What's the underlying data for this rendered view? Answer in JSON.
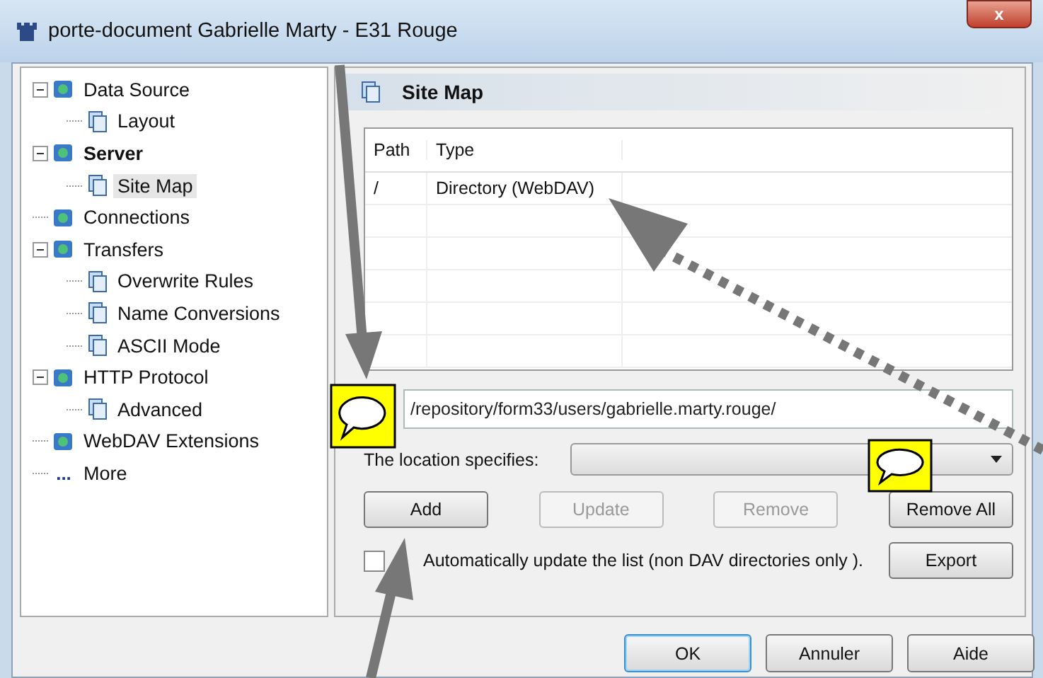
{
  "window": {
    "title": "porte-document Gabrielle Marty - E31 Rouge",
    "close": "x"
  },
  "tree": [
    {
      "label": "Data Source",
      "bold": false,
      "selected": false,
      "expanded": true,
      "children": [
        {
          "label": "Layout",
          "bold": false,
          "selected": false
        }
      ]
    },
    {
      "label": "Server",
      "bold": true,
      "selected": false,
      "expanded": true,
      "children": [
        {
          "label": "Site Map",
          "bold": false,
          "selected": true
        }
      ]
    },
    {
      "label": "Connections",
      "bold": false,
      "selected": false
    },
    {
      "label": "Transfers",
      "bold": false,
      "selected": false,
      "expanded": true,
      "children": [
        {
          "label": "Overwrite Rules",
          "bold": false,
          "selected": false
        },
        {
          "label": "Name Conversions",
          "bold": false,
          "selected": false
        },
        {
          "label": "ASCII Mode",
          "bold": false,
          "selected": false
        }
      ]
    },
    {
      "label": "HTTP Protocol",
      "bold": false,
      "selected": false,
      "expanded": true,
      "children": [
        {
          "label": "Advanced",
          "bold": false,
          "selected": false
        }
      ]
    },
    {
      "label": "WebDAV Extensions",
      "bold": false,
      "selected": false
    },
    {
      "label": "More",
      "bold": false,
      "selected": false,
      "kind": "more",
      "icon": "..."
    }
  ],
  "panel": {
    "title": "Site Map",
    "table": {
      "columns": [
        "Path",
        "Type"
      ],
      "rows": [
        [
          "/",
          "Directory (WebDAV)"
        ]
      ]
    },
    "path_input": {
      "value": "/repository/form33/users/gabrielle.marty.rouge/"
    },
    "location": {
      "label": "The location specifies:"
    },
    "buttons": [
      {
        "label": "Add",
        "disabled": false
      },
      {
        "label": "Update",
        "disabled": true
      },
      {
        "label": "Remove",
        "disabled": true
      },
      {
        "label": "Remove All",
        "disabled": false
      }
    ],
    "auto_update": {
      "label": "Automatically update the list (non DAV directories only ).",
      "checked": false
    },
    "export_button": "Export"
  },
  "footer_buttons": [
    {
      "label": "OK",
      "default": true
    },
    {
      "label": "Annuler",
      "default": false
    },
    {
      "label": "Aide",
      "default": false
    }
  ]
}
